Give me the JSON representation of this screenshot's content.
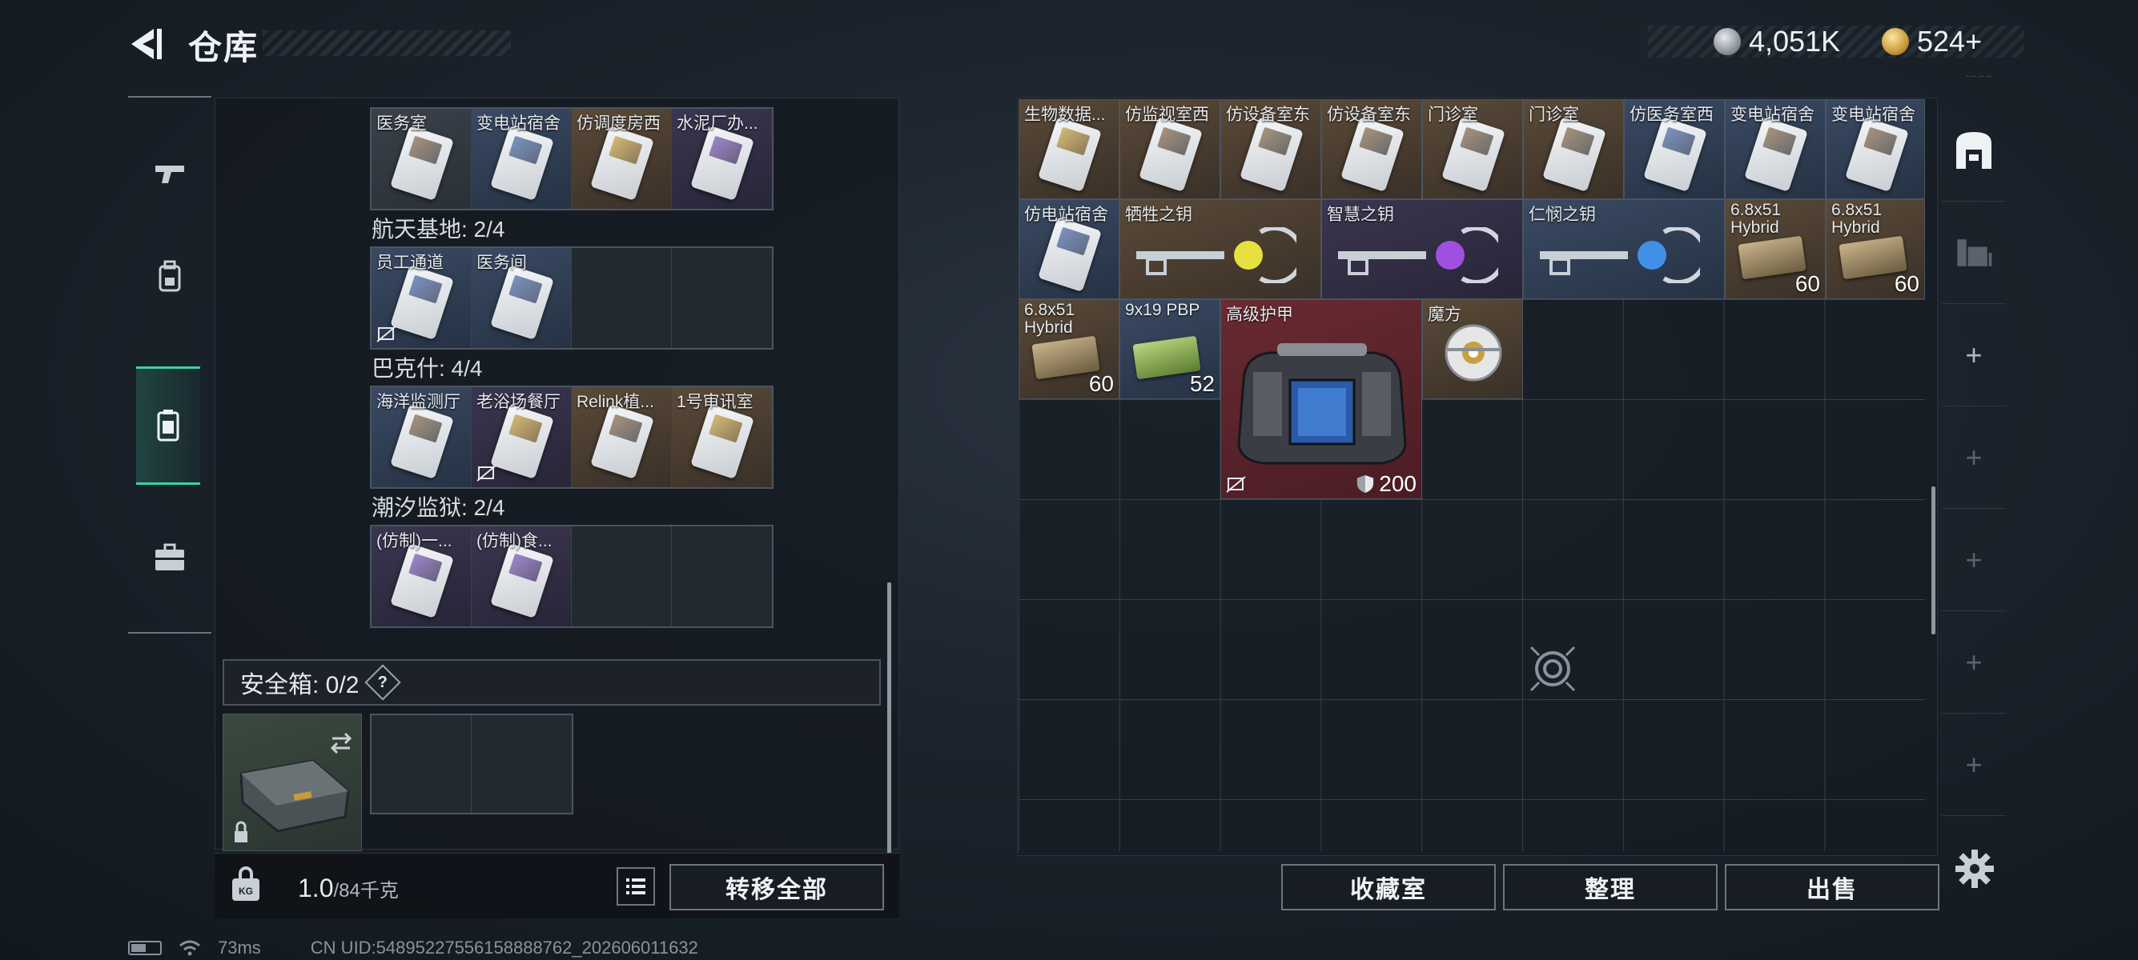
{
  "header": {
    "title": "仓库",
    "currencies": [
      {
        "icon": "silver-coin-icon",
        "value": "4,051K"
      },
      {
        "icon": "gold-coin-icon",
        "value": "524+"
      }
    ],
    "hud_tiny": "···· ·· ··"
  },
  "left_tabs": [
    {
      "name": "weapons",
      "icon": "pistol-icon",
      "active": false
    },
    {
      "name": "armor",
      "icon": "backpack-icon",
      "active": false
    },
    {
      "name": "keys",
      "icon": "keycard-case-icon",
      "active": true
    },
    {
      "name": "safe",
      "icon": "briefcase-icon",
      "active": false
    }
  ],
  "keycards": {
    "row1": [
      {
        "label": "医务室",
        "color": "gray"
      },
      {
        "label": "变电站宿舍",
        "color": "blue"
      },
      {
        "label": "仿调度房西",
        "color": "gold"
      },
      {
        "label": "水泥厂办...",
        "color": "purple"
      }
    ],
    "section2": "航天基地: 2/4",
    "row2": [
      {
        "label": "员工通道",
        "color": "blue"
      },
      {
        "label": "医务间",
        "color": "blue"
      },
      {
        "label": "",
        "color": "empty"
      },
      {
        "label": "",
        "color": "empty"
      }
    ],
    "section3": "巴克什: 4/4",
    "row3": [
      {
        "label": "海洋监测厅",
        "color": "blue"
      },
      {
        "label": "老浴场餐厅",
        "color": "purple"
      },
      {
        "label": "Relink植...",
        "color": "gold"
      },
      {
        "label": "1号审讯室",
        "color": "gold"
      }
    ],
    "section4": "潮汐监狱: 2/4",
    "row4": [
      {
        "label": "(仿制)一...",
        "color": "purple"
      },
      {
        "label": "(仿制)食...",
        "color": "purple"
      },
      {
        "label": "",
        "color": "empty"
      },
      {
        "label": "",
        "color": "empty"
      }
    ]
  },
  "safe_box": {
    "label": "安全箱: 0/2",
    "help": "?"
  },
  "left_footer": {
    "weight_value": "1.0",
    "weight_unit": "/84千克",
    "transfer_all": "转移全部"
  },
  "stash": {
    "row1": [
      "生物数据...",
      "仿监视室西",
      "仿设备室东",
      "仿设备室东",
      "门诊室",
      "门诊室",
      "仿医务室西",
      "变电站宿舍",
      "变电站宿舍"
    ],
    "keys": [
      {
        "label": "仿电站宿舍"
      },
      {
        "label": "牺牲之钥"
      },
      {
        "label": "智慧之钥"
      },
      {
        "label": "仁悯之钥"
      }
    ],
    "ammo": [
      {
        "label": "6.8x51 Hybrid",
        "count": "60"
      },
      {
        "label": "6.8x51 Hybrid",
        "count": "60"
      },
      {
        "label": "6.8x51 Hybrid",
        "count": "60"
      },
      {
        "label": "9x19 PBP",
        "count": "52"
      }
    ],
    "armor": {
      "label": "高级护甲",
      "durability": "200"
    },
    "cube": {
      "label": "魔方"
    }
  },
  "right_footer": {
    "collection": "收藏室",
    "sort": "整理",
    "sell": "出售"
  },
  "status": {
    "ping": "73ms",
    "uid": "CN UID:54895227556158888762_202606011632"
  }
}
